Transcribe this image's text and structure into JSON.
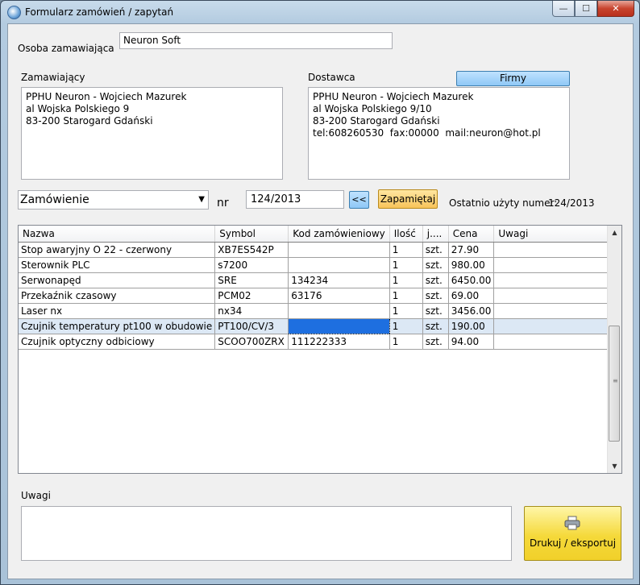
{
  "window": {
    "title": "Formularz zamówień / zapytań",
    "min_glyph": "—",
    "max_glyph": "☐",
    "close_glyph": "✕"
  },
  "orderer": {
    "label": "Osoba zamawiająca",
    "value": "Neuron Soft"
  },
  "buyer": {
    "label": "Zamawiający",
    "text": "PPHU Neuron - Wojciech Mazurek\nal Wojska Polskiego 9\n83-200 Starogard Gdański"
  },
  "supplier": {
    "label": "Dostawca",
    "companies_button": "Firmy",
    "text": "PPHU Neuron - Wojciech Mazurek\nal Wojska Polskiego 9/10\n83-200 Starogard Gdański\ntel:608260530  fax:00000  mail:neuron@hot.pl"
  },
  "document": {
    "type_selected": "Zamówienie",
    "nr_label": "nr",
    "number": "124/2013",
    "prev_button": "<<",
    "save_button": "Zapamiętaj",
    "last_used_label": "Ostatnio użyty numer:",
    "last_used_value": "124/2013"
  },
  "table": {
    "columns": [
      "Nazwa",
      "Symbol",
      "Kod zamówieniowy",
      "Ilość",
      "j....",
      "Cena",
      "Uwagi"
    ],
    "rows": [
      [
        "Stop awaryjny O 22 - czerwony",
        "XB7ES542P",
        "",
        "1",
        "szt.",
        "27.90",
        ""
      ],
      [
        "Sterownik PLC",
        "s7200",
        "",
        "1",
        "szt.",
        "980.00",
        ""
      ],
      [
        "Serwonapęd",
        "SRE",
        "134234",
        "1",
        "szt.",
        "6450.00",
        ""
      ],
      [
        "Przekaźnik czasowy",
        "PCM02",
        "63176",
        "1",
        "szt.",
        "69.00",
        ""
      ],
      [
        "Laser nx",
        "nx34",
        "",
        "1",
        "szt.",
        "3456.00",
        ""
      ],
      [
        "Czujnik temperatury pt100 w obudowie",
        "PT100/CV/3",
        "",
        "1",
        "szt.",
        "190.00",
        ""
      ],
      [
        "Czujnik optyczny odbiciowy",
        "SCOO700ZRX",
        "111222333",
        "1",
        "szt.",
        "94.00",
        ""
      ]
    ],
    "selected_row": 5
  },
  "notes": {
    "label": "Uwagi",
    "value": ""
  },
  "print_button": {
    "label": "Drukuj / eksportuj",
    "icon": "printer-icon"
  }
}
